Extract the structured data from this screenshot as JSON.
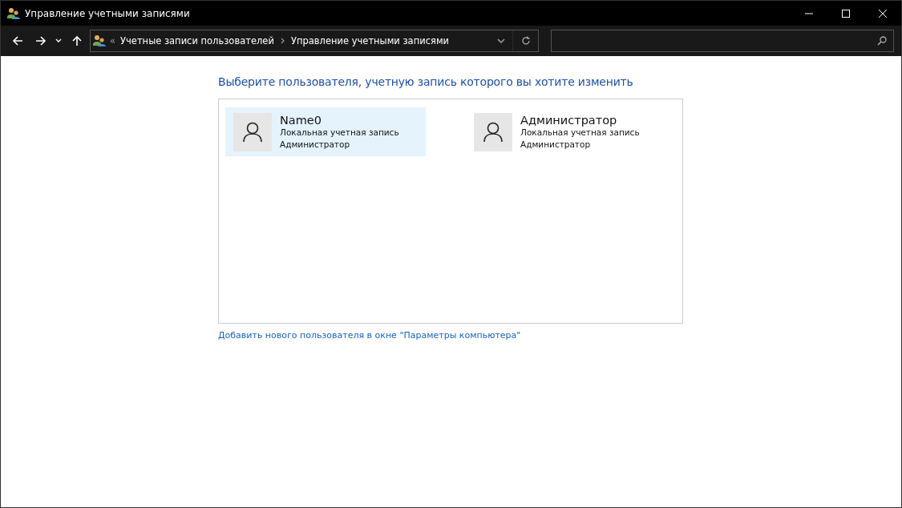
{
  "window": {
    "title": "Управление учетными записями"
  },
  "breadcrumb": {
    "overflow": "«",
    "items": [
      "Учетные записи пользователей",
      "Управление учетными записями"
    ]
  },
  "heading": "Выберите пользователя, учетную запись которого вы хотите изменить",
  "accounts": [
    {
      "name": "Name0",
      "type": "Локальная учетная запись",
      "role": "Администратор",
      "selected": true
    },
    {
      "name": "Администратор",
      "type": "Локальная учетная запись",
      "role": "Администратор",
      "selected": false
    }
  ],
  "add_user_link": "Добавить нового пользователя в окне \"Параметры компьютера\""
}
